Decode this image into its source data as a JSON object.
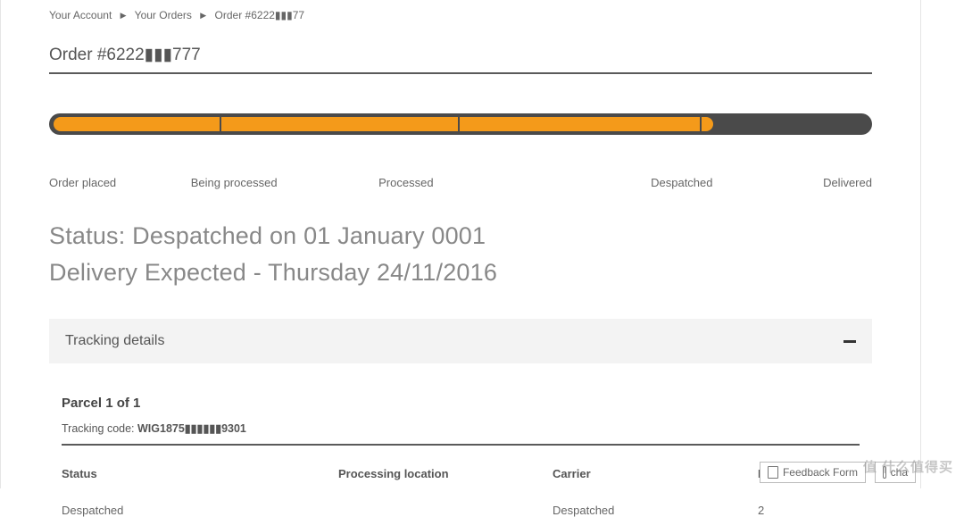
{
  "breadcrumb": {
    "account": "Your Account",
    "orders": "Your Orders",
    "current": "Order #6222▮▮▮77"
  },
  "order": {
    "title": "Order #6222▮▮▮777"
  },
  "progress": {
    "labels": {
      "placed": "Order placed",
      "processing": "Being processed",
      "processed": "Processed",
      "despatched": "Despatched",
      "delivered": "Delivered"
    }
  },
  "status": {
    "line1": "Status: Despatched on 01 January 0001",
    "line2": "Delivery Expected - Thursday 24/11/2016"
  },
  "tracking": {
    "header": "Tracking details",
    "parcel_label": "Parcel 1 of 1",
    "code_label": "Tracking code: ",
    "code_value": "WIG1875▮▮▮▮▮▮9301",
    "columns": {
      "status": "Status",
      "location": "Processing location",
      "carrier": "Carrier",
      "date": "Date"
    },
    "row": {
      "status": "Despatched",
      "location": "",
      "carrier": "Despatched",
      "date": "2"
    }
  },
  "bottom": {
    "feedback": "Feedback Form",
    "chat": "cha"
  },
  "watermark": "什么值得买"
}
